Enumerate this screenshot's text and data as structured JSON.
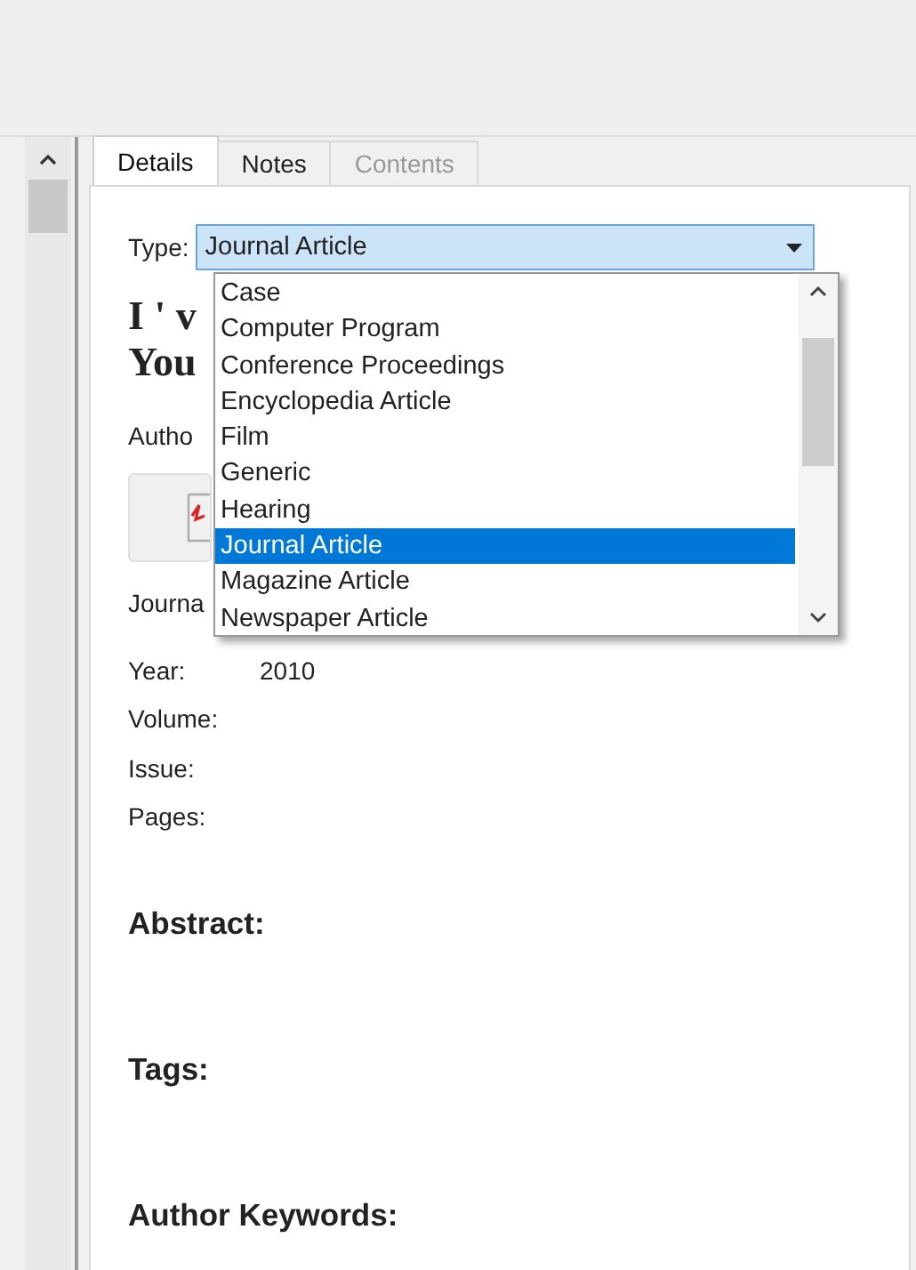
{
  "tabs": [
    {
      "label": "Details",
      "selected": true,
      "disabled": false
    },
    {
      "label": "Notes",
      "selected": false,
      "disabled": false
    },
    {
      "label": "Contents",
      "selected": false,
      "disabled": true
    }
  ],
  "type_field": {
    "label": "Type:",
    "value": "Journal Article"
  },
  "type_dropdown": {
    "items": [
      {
        "label": "Case",
        "selected": false
      },
      {
        "label": "Computer Program",
        "selected": false
      },
      {
        "label": "Conference Proceedings",
        "selected": false
      },
      {
        "label": "Encyclopedia Article",
        "selected": false
      },
      {
        "label": "Film",
        "selected": false
      },
      {
        "label": "Generic",
        "selected": false
      },
      {
        "label": "Hearing",
        "selected": false
      },
      {
        "label": "Journal Article",
        "selected": true
      },
      {
        "label": "Magazine Article",
        "selected": false
      },
      {
        "label": "Newspaper Article",
        "selected": false
      }
    ]
  },
  "title_lines": [
    "I ' v",
    "You"
  ],
  "author_label": "Autho",
  "journal_label": "Journa",
  "fields": [
    {
      "label": "Year:",
      "value": "2010"
    },
    {
      "label": "Volume:"
    },
    {
      "label": "Issue:"
    },
    {
      "label": "Pages:"
    }
  ],
  "sections": [
    "Abstract:",
    "Tags:",
    "Author Keywords:"
  ]
}
